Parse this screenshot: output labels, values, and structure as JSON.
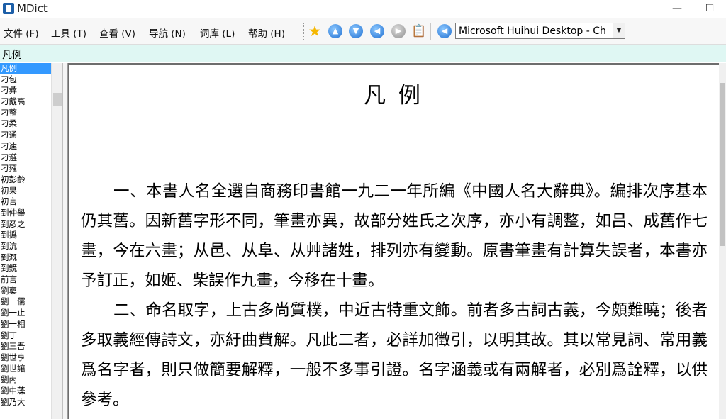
{
  "window": {
    "title": "MDict",
    "minimize": "—",
    "maximize": "☐",
    "close": "✕"
  },
  "menu": [
    {
      "label": "文件 (F)"
    },
    {
      "label": "工具 (T)"
    },
    {
      "label": "查看 (V)"
    },
    {
      "label": "导航 (N)"
    },
    {
      "label": "词库 (L)"
    },
    {
      "label": "帮助 (H)"
    }
  ],
  "toolbar": {
    "icons": [
      "star-icon",
      "arrow-up-icon",
      "arrow-down-icon",
      "arrow-left-icon",
      "arrow-right-icon",
      "clipboard-icon",
      "back-icon"
    ],
    "star_glyph": "★",
    "up_glyph": "▲",
    "down_glyph": "▼",
    "left_glyph": "◀",
    "right_glyph": "▶",
    "clip_glyph": "📋",
    "back_glyph": "◀",
    "dictionary_value": "Microsoft Huihui Desktop - Ch",
    "dropdown_glyph": "▼"
  },
  "search": {
    "value": "凡例"
  },
  "wordlist": [
    "凡例",
    "刁包",
    "刁彝",
    "刁戴高",
    "刁整",
    "刁柔",
    "刁通",
    "刁逵",
    "刁遵",
    "刁雍",
    "初彭齡",
    "初杲",
    "初言",
    "到仲舉",
    "到彦之",
    "到撝",
    "到沆",
    "到溉",
    "到鏡",
    "前言",
    "劉稟",
    "劉一儒",
    "劉一止",
    "劉一相",
    "劉丁",
    "劉三吾",
    "劉世亨",
    "劉世讓",
    "劉丙",
    "劉中藻",
    "劉乃大"
  ],
  "content": {
    "title": "凡 例",
    "paragraph1": "一、本書人名全選自商務印書館一九二一年所編《中國人名大辭典》。編排次序基本仍其舊。因新舊字形不同，筆畫亦異，故部分姓氏之次序，亦小有調整，如吕、成舊作七畫，今在六畫；从邑、从阜、从艸諸姓，排列亦有變動。原書筆畫有計算失誤者，本書亦予訂正，如姬、柴誤作九畫，今移在十畫。",
    "paragraph2": "二、命名取字，上古多尚質樸，中近古特重文飾。前者多古詞古義，今頗難曉；後者多取義經傳詩文，亦紆曲費解。凡此二者，必詳加徵引，以明其故。其以常見詞、常用義爲名字者，則只做簡要解釋，一般不多事引證。名字涵義或有兩解者，必別爲詮釋，以供參考。"
  }
}
